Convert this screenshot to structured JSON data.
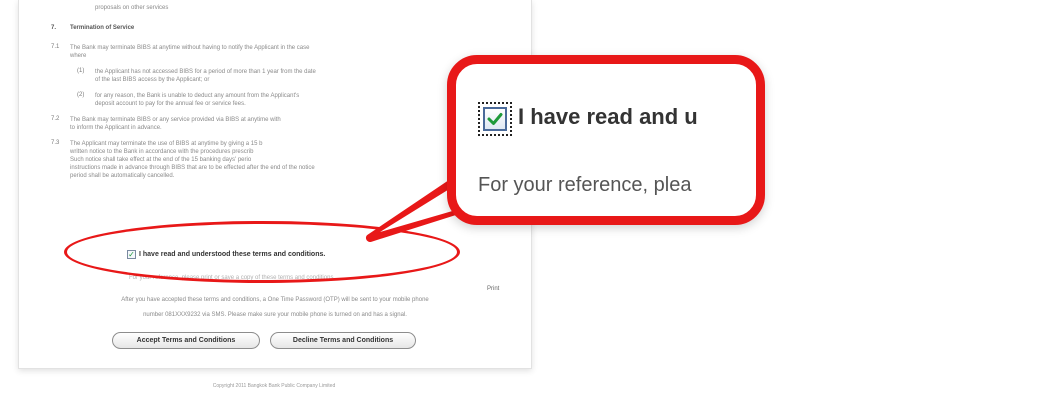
{
  "document": {
    "top_fragment": "proposals on other services",
    "section": {
      "number": "7.",
      "title": "Termination of Service"
    },
    "clauses": [
      {
        "num": "7.1",
        "lines": [
          "The Bank may terminate BIBS at anytime without having to notify the Applicant in the case",
          "where"
        ]
      },
      {
        "num": "(1)",
        "lines": [
          "the Applicant has not accessed BIBS for a period of more than 1 year from the date",
          "of the last BIBS access by the Applicant; or"
        ]
      },
      {
        "num": "(2)",
        "lines": [
          "for any reason, the Bank is unable to deduct any amount from the Applicant's",
          "deposit account to pay for the annual fee or service fees."
        ]
      },
      {
        "num": "7.2",
        "lines": [
          "The Bank may terminate BIBS or any service provided via BIBS at anytime with",
          "to inform the Applicant in advance."
        ]
      },
      {
        "num": "7.3",
        "lines": [
          "The Applicant may terminate the use of BIBS at anytime by giving a 15 b",
          "written notice to the Bank in accordance with the procedures prescrib",
          "Such notice shall take effect at the end of the 15 banking days' perio",
          "instructions made in advance through BIBS that are to be effected after the end of the notice",
          "period shall be automatically cancelled."
        ]
      }
    ],
    "agree_label": "I have read and understood these terms and conditions.",
    "reference_line": "For your reference, please print or save a copy of these terms and conditions.",
    "print_label": "Print",
    "otp_lines": [
      "After you have accepted these terms and conditions, a One Time Password (OTP) will be sent to your mobile phone",
      "number 081XXX9232 via SMS.  Please make sure your mobile phone is turned on and has a signal."
    ],
    "buttons": {
      "accept": "Accept Terms and Conditions",
      "decline": "Decline Terms and Conditions"
    },
    "copyright": "Copyright 2011 Bangkok Bank Public Company Limited"
  },
  "callout": {
    "label": "I have read and u",
    "reference": "For your reference, plea"
  },
  "colors": {
    "highlight_red": "#e81818",
    "check_green": "#1e9a3a"
  },
  "icons": {
    "checkbox": "checked-checkbox-icon"
  }
}
